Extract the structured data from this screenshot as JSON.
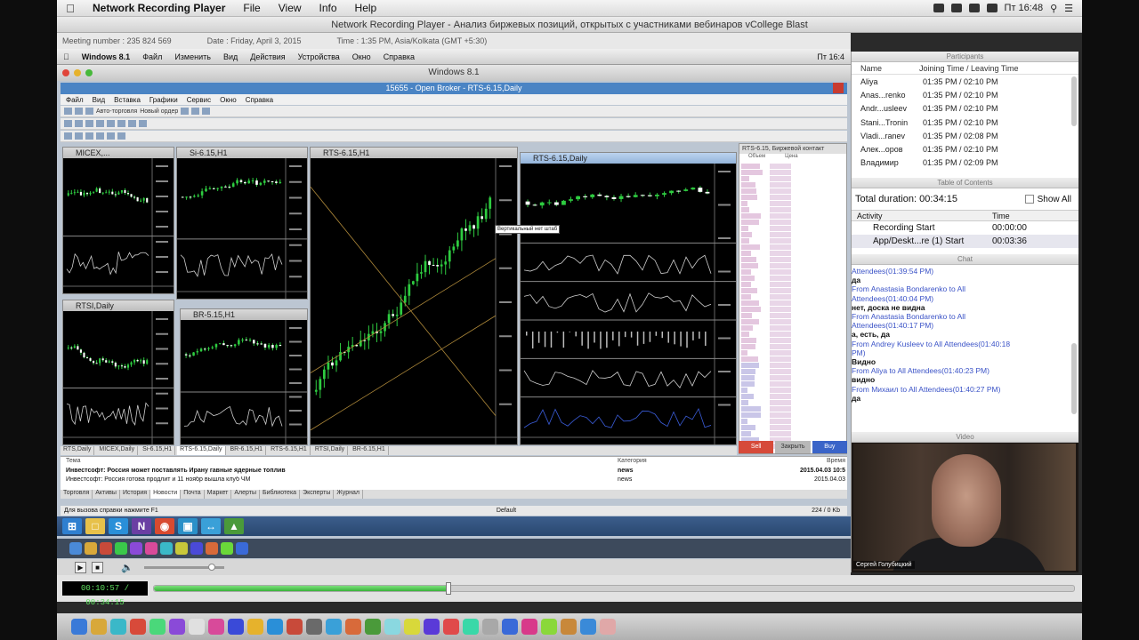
{
  "mac_menubar": {
    "app_name": "Network Recording Player",
    "items": [
      "File",
      "View",
      "Info",
      "Help"
    ],
    "clock": "Пт 16:48"
  },
  "player": {
    "window_title": "Network Recording Player - Анализ биржевых позиций, открытых с участниками вебинаров vCollege Blast",
    "meeting_number": "Meeting number : 235 824 569",
    "date": "Date : Friday, April 3, 2015",
    "time": "Time : 1:35 PM, Asia/Kolkata (GMT +5:30)"
  },
  "win_menubar": {
    "title": "Windows 8.1",
    "items": [
      "Файл",
      "Изменить",
      "Вид",
      "Действия",
      "Устройства",
      "Окно",
      "Справка"
    ],
    "clock": "Пт 16:4"
  },
  "vm_window_title": "Windows 8.1",
  "app": {
    "title": "15655 - Open Broker - RTS-6.15,Daily",
    "menu": [
      "Файл",
      "Вид",
      "Вставка",
      "Графики",
      "Сервис",
      "Окно",
      "Справка"
    ],
    "toolbar_text": "Авто-торговля",
    "toolbar_text2": "Новый ордер"
  },
  "charts": [
    {
      "id": "micex",
      "title": "MICEX,..."
    },
    {
      "id": "si",
      "title": "Si-6.15,H1"
    },
    {
      "id": "rts_h1",
      "title": "RTS-6.15,H1"
    },
    {
      "id": "rts_daily",
      "title": "RTS-6.15,Daily"
    },
    {
      "id": "rtsi",
      "title": "RTSI,Daily"
    },
    {
      "id": "br",
      "title": "BR-5.15,H1"
    }
  ],
  "tooltip": "Вертикальный нет штаб",
  "dom": {
    "title": "RTS-6.15, Биржевой контакт",
    "col_vol": "Объем",
    "col_price": "Цена",
    "buttons": [
      "Sell",
      "Закрыть",
      "Buy"
    ]
  },
  "chart_tabs": [
    "RTS,Daily",
    "MICEX,Daily",
    "Si-6.15,H1",
    "RTS-6.15,Daily",
    "BR-6.15,H1",
    "RTS-6.15,H1",
    "RTSI,Daily",
    "BR-6.15,H1"
  ],
  "news": {
    "col_topic": "Тема",
    "col_category": "Категория",
    "col_time": "Время",
    "rows": [
      {
        "topic": "Инвестсофт: Россия может поставлять Ирану гавные ядерные топлив",
        "category": "news",
        "time": "2015.04.03 10:5"
      },
      {
        "topic": "Инвестсофт: Россия готова продлит и 11 ноябр вышла клуб ЧМ",
        "category": "news",
        "time": "2015.04.03"
      }
    ]
  },
  "bottom_tabs": [
    "Торговля",
    "Активы",
    "История",
    "Новости",
    "Почта",
    "Маркет",
    "Алерты",
    "Библиотека",
    "Эксперты",
    "Журнал"
  ],
  "status": {
    "left": "Для вызова справки нажмите F1",
    "mid": "Default",
    "right": "224 / 0 Kb"
  },
  "participants": {
    "title": "Participants",
    "col_name": "Name",
    "col_time": "Joining Time / Leaving Time",
    "rows": [
      {
        "name": "Aliya",
        "time": "01:35 PM / 02:10 PM"
      },
      {
        "name": "Anas...renko",
        "time": "01:35 PM / 02:10 PM"
      },
      {
        "name": "Andr...usleev",
        "time": "01:35 PM / 02:10 PM"
      },
      {
        "name": "Stani...Tronin",
        "time": "01:35 PM / 02:10 PM"
      },
      {
        "name": "Vladi...ranev",
        "time": "01:35 PM / 02:08 PM"
      },
      {
        "name": "Алек...оров",
        "time": "01:35 PM / 02:10 PM"
      },
      {
        "name": "Владимир",
        "time": "01:35 PM / 02:09 PM"
      }
    ]
  },
  "toc": {
    "title": "Table of Contents",
    "total_duration": "Total duration: 00:34:15",
    "show_all": "Show All",
    "col_activity": "Activity",
    "col_time": "Time",
    "rows": [
      {
        "activity": "Recording Start",
        "time": "00:00:00"
      },
      {
        "activity": "App/Deskt...re (1) Start",
        "time": "00:03:36"
      }
    ]
  },
  "chat": {
    "title": "Chat",
    "lines": [
      {
        "kind": "from",
        "text": "Attendees(01:39:54 PM)"
      },
      {
        "kind": "msg",
        "text": "да"
      },
      {
        "kind": "from",
        "text": "From Anastasia Bondarenko to All"
      },
      {
        "kind": "from",
        "text": "Attendees(01:40:04 PM)"
      },
      {
        "kind": "msg",
        "text": "нет, доска не видна"
      },
      {
        "kind": "from",
        "text": "From Anastasia Bondarenko to All"
      },
      {
        "kind": "from",
        "text": "Attendees(01:40:17 PM)"
      },
      {
        "kind": "msg",
        "text": "а, есть, да"
      },
      {
        "kind": "from",
        "text": "From Andrey Kusleev to All Attendees(01:40:18"
      },
      {
        "kind": "from",
        "text": "PM)"
      },
      {
        "kind": "msg",
        "text": "Видно"
      },
      {
        "kind": "from",
        "text": "From Aliya to All Attendees(01:40:23 PM)"
      },
      {
        "kind": "msg",
        "text": "видно"
      },
      {
        "kind": "from",
        "text": "From Михаил to All Attendees(01:40:27 PM)"
      },
      {
        "kind": "msg",
        "text": "да"
      }
    ]
  },
  "video": {
    "title": "Video",
    "caption": "Сергей Голубицкий"
  },
  "playback": {
    "time_display": "00:10:57 / 00:34:15",
    "progress": 0.3197,
    "volume": 0.85
  },
  "colors": {
    "chart_bg": "#000000",
    "candle_up": "#2ecc40",
    "progress_fill": "#3bb33b"
  }
}
